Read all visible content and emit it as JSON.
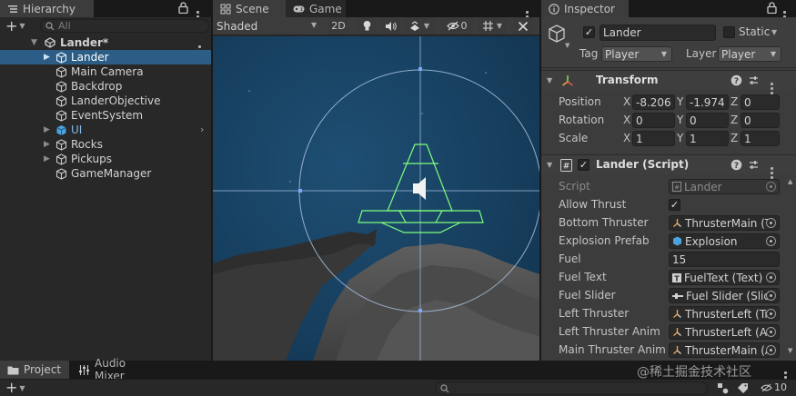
{
  "hierarchy": {
    "tab_label": "Hierarchy",
    "search_placeholder": "All",
    "scene_name": "Lander*",
    "items": [
      {
        "label": "Lander",
        "selected": true,
        "foldable": true
      },
      {
        "label": "Main Camera"
      },
      {
        "label": "Backdrop"
      },
      {
        "label": "LanderObjective"
      },
      {
        "label": "EventSystem"
      },
      {
        "label": "UI",
        "foldable": true
      },
      {
        "label": "Rocks",
        "foldable": true
      },
      {
        "label": "Pickups",
        "foldable": true
      },
      {
        "label": "GameManager"
      }
    ]
  },
  "scene": {
    "tab_scene": "Scene",
    "tab_game": "Game",
    "shading_mode": "Shaded",
    "mode_2d": "2D",
    "hidden_count": "0"
  },
  "inspector": {
    "tab_label": "Inspector",
    "object_name": "Lander",
    "static_label": "Static",
    "tag_label": "Tag",
    "tag_value": "Player",
    "layer_label": "Layer",
    "layer_value": "Player",
    "transform": {
      "title": "Transform",
      "rows": [
        {
          "label": "Position",
          "x": "-8.206",
          "y": "-1.974",
          "z": "0"
        },
        {
          "label": "Rotation",
          "x": "0",
          "y": "0",
          "z": "0"
        },
        {
          "label": "Scale",
          "x": "1",
          "y": "1",
          "z": "1"
        }
      ],
      "axis_x": "X",
      "axis_y": "Y",
      "axis_z": "Z"
    },
    "script_component": {
      "title": "Lander (Script)",
      "script_label": "Script",
      "script_value": "Lander",
      "fields": [
        {
          "label": "Allow Thrust",
          "type": "checkbox",
          "value": "✓"
        },
        {
          "label": "Bottom Thruster",
          "type": "object",
          "value": "ThrusterMain (T",
          "icon": "particle-icon"
        },
        {
          "label": "Explosion Prefab",
          "type": "object",
          "value": "Explosion",
          "icon": "prefab-icon"
        },
        {
          "label": "Fuel",
          "type": "number",
          "value": "15"
        },
        {
          "label": "Fuel Text",
          "type": "object",
          "value": "FuelText (Text)",
          "icon": "text-icon"
        },
        {
          "label": "Fuel Slider",
          "type": "object",
          "value": "Fuel Slider (Slid",
          "icon": "slider-icon"
        },
        {
          "label": "Left Thruster",
          "type": "object",
          "value": "ThrusterLeft (Tr",
          "icon": "particle-icon"
        },
        {
          "label": "Left Thruster Anim",
          "type": "object",
          "value": "ThrusterLeft (Ar",
          "icon": "particle-icon"
        },
        {
          "label": "Main Thruster Anim",
          "type": "object",
          "value": "ThrusterMain (A",
          "icon": "particle-icon"
        }
      ]
    }
  },
  "bottom": {
    "tab_project": "Project",
    "tab_audio": "Audio Mixer",
    "watermark": "@稀土掘金技术社区",
    "count": "10"
  }
}
